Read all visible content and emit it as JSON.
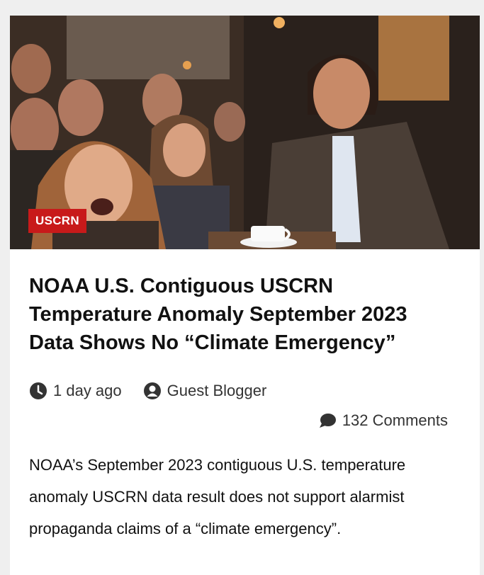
{
  "article": {
    "category_badge": "USCRN",
    "title": "NOAA U.S. Contiguous USCRN Temperature Anomaly September 2023 Data Shows No “Climate Emergency”",
    "date": "1 day ago",
    "author": "Guest Blogger",
    "comments": "132 Comments",
    "excerpt": "NOAA’s September 2023 contiguous U.S. temperature anomaly USCRN data result does not support alarmist propaganda claims of a “climate emergency”."
  },
  "icons": {
    "date": "clock-icon",
    "author": "user-icon",
    "comments": "comment-icon"
  },
  "colors": {
    "badge": "#c81a1a",
    "page_background": "#efefef",
    "card_background": "#ffffff",
    "text": "#111111"
  }
}
